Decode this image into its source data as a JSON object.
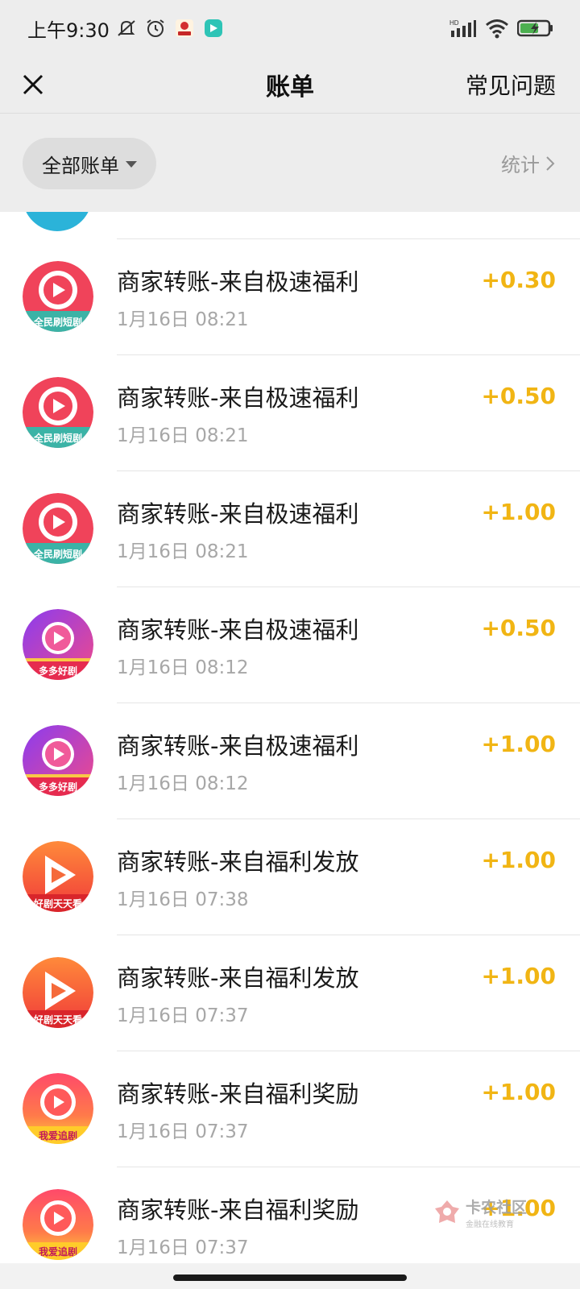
{
  "status": {
    "time": "上午9:30",
    "icons_left": [
      "mute-icon",
      "alarm-icon",
      "app-badge-icon",
      "app-badge2-icon"
    ],
    "icons_right": [
      "hd-signal-icon",
      "wifi-icon",
      "battery-charging-icon"
    ]
  },
  "header": {
    "title": "账单",
    "faq_label": "常见问题"
  },
  "filter": {
    "dropdown_label": "全部账单",
    "stats_label": "统计"
  },
  "colors": {
    "amount": "#f1b514",
    "background": "#ededed"
  },
  "transactions": [
    {
      "title": "商家转账-来自极速福利",
      "time": "1月16日 08:21",
      "amount": "+0.30",
      "icon": "quanmin-shuaduanju-app-icon"
    },
    {
      "title": "商家转账-来自极速福利",
      "time": "1月16日 08:21",
      "amount": "+0.50",
      "icon": "quanmin-shuaduanju-app-icon"
    },
    {
      "title": "商家转账-来自极速福利",
      "time": "1月16日 08:21",
      "amount": "+1.00",
      "icon": "quanmin-shuaduanju-app-icon"
    },
    {
      "title": "商家转账-来自极速福利",
      "time": "1月16日 08:12",
      "amount": "+0.50",
      "icon": "duoduo-haoju-app-icon"
    },
    {
      "title": "商家转账-来自极速福利",
      "time": "1月16日 08:12",
      "amount": "+1.00",
      "icon": "duoduo-haoju-app-icon"
    },
    {
      "title": "商家转账-来自福利发放",
      "time": "1月16日 07:38",
      "amount": "+1.00",
      "icon": "haoju-tiantian-app-icon"
    },
    {
      "title": "商家转账-来自福利发放",
      "time": "1月16日 07:37",
      "amount": "+1.00",
      "icon": "haoju-tiantian-app-icon"
    },
    {
      "title": "商家转账-来自福利奖励",
      "time": "1月16日 07:37",
      "amount": "+1.00",
      "icon": "woai-zhuiju-app-icon"
    },
    {
      "title": "商家转账-来自福利奖励",
      "time": "1月16日 07:37",
      "amount": "+1.00",
      "icon": "woai-zhuiju-app-icon"
    }
  ],
  "watermark": {
    "main": "卡农社区",
    "sub": "金融在线教育"
  }
}
